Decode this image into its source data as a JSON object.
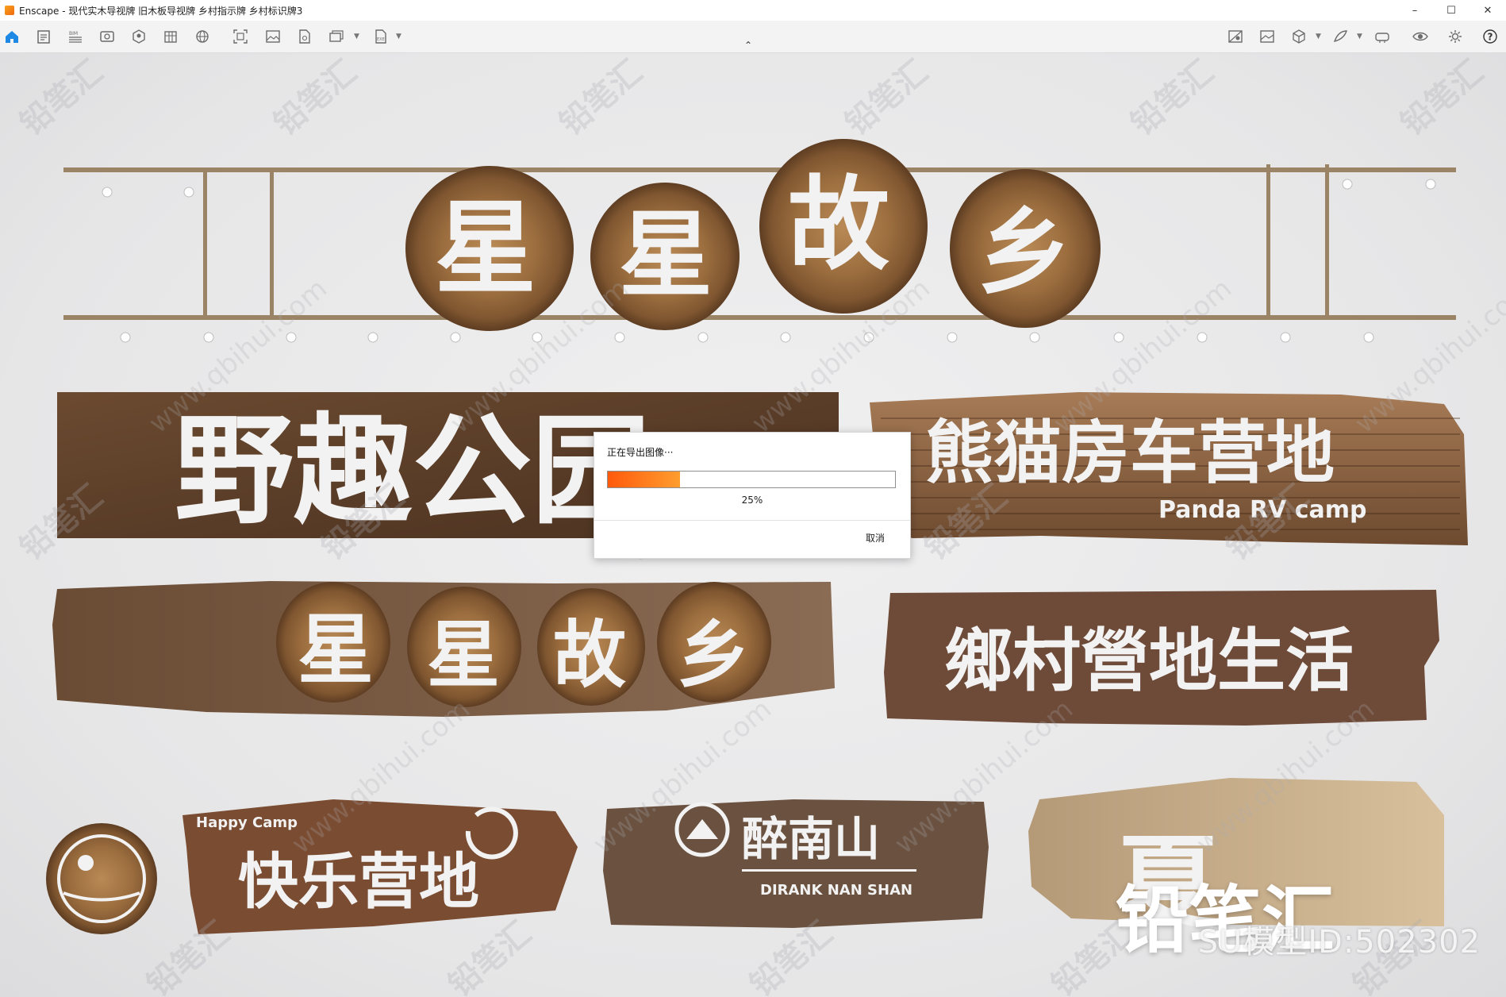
{
  "window": {
    "app_name": "Enscape",
    "title": "Enscape - 现代实木导视牌 旧木板导视牌 乡村指示牌 乡村标识牌3",
    "controls": [
      "minimize",
      "maximize",
      "close"
    ]
  },
  "toolbar": {
    "left_icons": [
      "home-icon",
      "notes-icon",
      "bim-icon",
      "video-icon",
      "orbit-icon",
      "asset-library-icon",
      "panorama-icon",
      "screenshot-icon",
      "image-icon",
      "export-file-icon",
      "batch-render-icon",
      "exe-export-icon"
    ],
    "right_icons": [
      "material-icon",
      "visual-settings-icon",
      "view-cube-icon",
      "sketch-icon",
      "vr-headset-icon",
      "eye-icon",
      "settings-icon",
      "help-icon"
    ],
    "colors": {
      "home": "#1e88e5",
      "icon": "#6b6b6b"
    }
  },
  "scene": {
    "signs": [
      {
        "text": "星星故乡"
      },
      {
        "text": "野趣公园"
      },
      {
        "text": "熊猫房车营地",
        "subtext": "Panda RV camp"
      },
      {
        "text": "星星故乡"
      },
      {
        "text": "鄉村營地生活"
      },
      {
        "text": "快乐营地",
        "subtext": "Happy Camp"
      },
      {
        "text": "醉南山",
        "subtext": "DIRANK NAN SHAN"
      },
      {
        "text": "夏"
      }
    ],
    "brand_overlay": "铅笔汇",
    "model_id": "SU模型ID:502302",
    "watermark_cn": "铅笔汇",
    "watermark_url": "www.qbihui.com"
  },
  "dialog": {
    "title": "正在导出图像···",
    "progress_percent": 25,
    "progress_label": "25%",
    "cancel_label": "取消",
    "fill_colors": [
      "#ff5a0c",
      "#ff9d2e"
    ]
  }
}
